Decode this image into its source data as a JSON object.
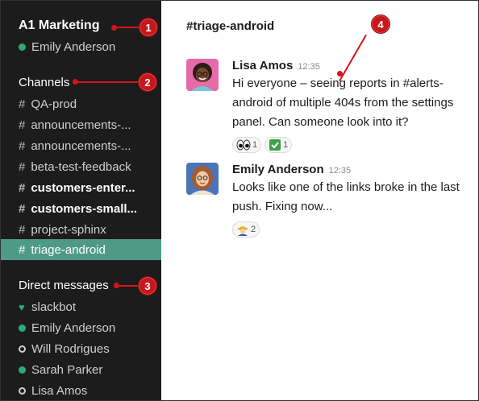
{
  "sidebar": {
    "workspace_name": "A1 Marketing",
    "current_user": "Emily Anderson",
    "channels_title": "Channels",
    "channels": [
      {
        "label": "QA-prod"
      },
      {
        "label": "announcements-..."
      },
      {
        "label": "announcements-..."
      },
      {
        "label": "beta-test-feedback"
      },
      {
        "label": "customers-enter..."
      },
      {
        "label": "customers-small..."
      },
      {
        "label": "project-sphinx"
      },
      {
        "label": "triage-android"
      }
    ],
    "dm_title": "Direct messages",
    "dms": [
      {
        "label": "slackbot",
        "status": "bot"
      },
      {
        "label": "Emily Anderson",
        "status": "online"
      },
      {
        "label": "Will Rodrigues",
        "status": "away"
      },
      {
        "label": "Sarah Parker",
        "status": "online"
      },
      {
        "label": "Lisa Amos",
        "status": "away"
      }
    ]
  },
  "channel": {
    "title": "#triage-android"
  },
  "messages": [
    {
      "author": "Lisa Amos",
      "time": "12:35",
      "text": "Hi everyone – seeing reports in #alerts-android of multiple 404s from the settings panel. Can someone look into it?",
      "reactions": [
        {
          "icon": "eyes-emoji",
          "count": "1"
        },
        {
          "icon": "check-emoji",
          "count": "1"
        }
      ]
    },
    {
      "author": "Emily Anderson",
      "time": "12:35",
      "text": "Looks like one of the links broke in the last push. Fixing now...",
      "reactions": [
        {
          "icon": "construction-worker-emoji",
          "count": "2"
        }
      ]
    }
  ],
  "annotations": [
    "1",
    "2",
    "3",
    "4"
  ],
  "colors": {
    "sidebar_bg": "#1d1c1d",
    "active_channel": "#4f9a86",
    "online": "#2bac76",
    "annotation_red": "#c8161d"
  }
}
